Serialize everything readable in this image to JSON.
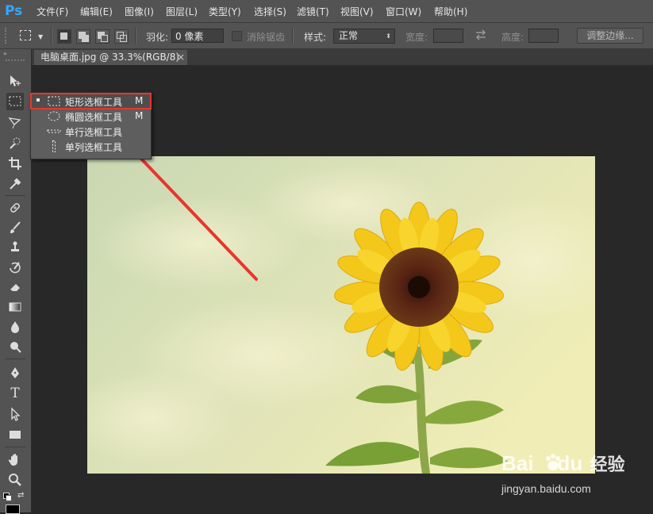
{
  "app": {
    "logo_text": "Ps"
  },
  "menu": [
    "文件(F)",
    "编辑(E)",
    "图像(I)",
    "图层(L)",
    "类型(Y)",
    "选择(S)",
    "滤镜(T)",
    "视图(V)",
    "窗口(W)",
    "帮助(H)"
  ],
  "options": {
    "feather_label": "羽化:",
    "feather_value": "0 像素",
    "antialias_label": "消除锯齿",
    "style_label": "样式:",
    "style_value": "正常",
    "width_label": "宽度:",
    "height_label": "高度:",
    "refine_edge_label": "调整边缘..."
  },
  "document": {
    "tab_title": "电脑桌面.jpg @ 33.3%(RGB/8)",
    "close_glyph": "×"
  },
  "flyout": {
    "items": [
      {
        "label": "矩形选框工具",
        "shortcut": "M",
        "icon": "rect-marquee-icon",
        "selected": true
      },
      {
        "label": "椭圆选框工具",
        "shortcut": "M",
        "icon": "elliptical-marquee-icon",
        "selected": false
      },
      {
        "label": "单行选框工具",
        "shortcut": "",
        "icon": "single-row-marquee-icon",
        "selected": false
      },
      {
        "label": "单列选框工具",
        "shortcut": "",
        "icon": "single-column-marquee-icon",
        "selected": false
      }
    ]
  },
  "toolbar": {
    "tools": [
      "move-icon",
      "rect-marquee-icon",
      "lasso-icon",
      "quick-select-icon",
      "crop-icon",
      "eyedropper-icon",
      "healing-brush-icon",
      "brush-icon",
      "clone-stamp-icon",
      "history-brush-icon",
      "eraser-icon",
      "gradient-icon",
      "blur-icon",
      "dodge-icon",
      "pen-icon",
      "type-icon",
      "path-select-icon",
      "rectangle-shape-icon",
      "hand-icon",
      "zoom-icon"
    ],
    "type_glyph": "T"
  },
  "watermark": {
    "brand_text": "Bai",
    "brand_text_2": "du",
    "brand_cn": "经验",
    "url": "jingyan.baidu.com"
  },
  "colors": {
    "annotation_red": "#e8352f",
    "ps_blue": "#31a8ff",
    "ui_gray": "#535353",
    "canvas_bg": "#282828"
  }
}
